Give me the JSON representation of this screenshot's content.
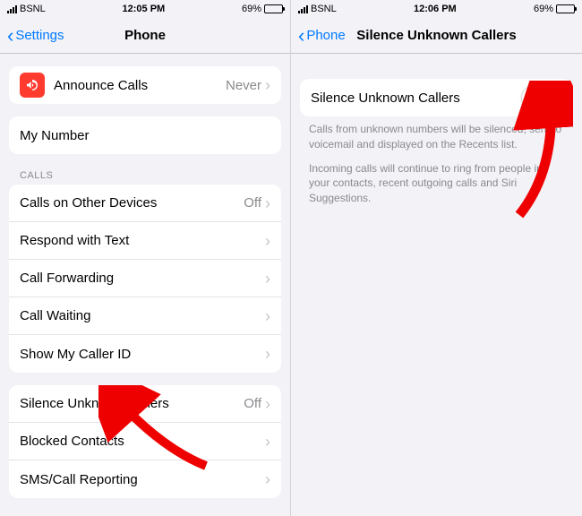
{
  "status": {
    "carrier": "BSNL",
    "time_left": "12:05 PM",
    "time_right": "12:06 PM",
    "battery": "69%"
  },
  "left": {
    "back": "Settings",
    "title": "Phone",
    "announce": {
      "label": "Announce Calls",
      "value": "Never"
    },
    "my_number": "My Number",
    "calls_header": "CALLS",
    "calls": [
      {
        "label": "Calls on Other Devices",
        "value": "Off"
      },
      {
        "label": "Respond with Text",
        "value": ""
      },
      {
        "label": "Call Forwarding",
        "value": ""
      },
      {
        "label": "Call Waiting",
        "value": ""
      },
      {
        "label": "Show My Caller ID",
        "value": ""
      }
    ],
    "extra": [
      {
        "label": "Silence Unknown Callers",
        "value": "Off"
      },
      {
        "label": "Blocked Contacts",
        "value": ""
      },
      {
        "label": "SMS/Call Reporting",
        "value": ""
      }
    ]
  },
  "right": {
    "back": "Phone",
    "title": "Silence Unknown Callers",
    "toggle_label": "Silence Unknown Callers",
    "desc1": "Calls from unknown numbers will be silenced, sent to voicemail and displayed on the Recents list.",
    "desc2": "Incoming calls will continue to ring from people in your contacts, recent outgoing calls and Siri Suggestions."
  },
  "colors": {
    "accent": "#007aff",
    "announce_icon_bg": "#ff3b30"
  }
}
